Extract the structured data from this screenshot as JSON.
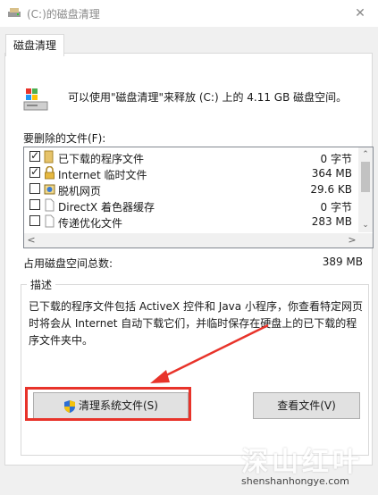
{
  "window": {
    "title": "(C:)的磁盘清理",
    "close_glyph": "✕"
  },
  "tab": {
    "label": "磁盘清理"
  },
  "header": {
    "info": "可以使用\"磁盘清理\"来释放 (C:) 上的 4.11 GB 磁盘空间。"
  },
  "files_label": "要删除的文件(F):",
  "files": [
    {
      "name": "已下载的程序文件",
      "size": "0 字节",
      "checked": true,
      "icon": "folder-icon"
    },
    {
      "name": "Internet 临时文件",
      "size": "364 MB",
      "checked": true,
      "icon": "lock-icon"
    },
    {
      "name": "脱机网页",
      "size": "29.6 KB",
      "checked": false,
      "icon": "offline-page-icon"
    },
    {
      "name": "DirectX 着色器缓存",
      "size": "0 字节",
      "checked": false,
      "icon": "file-icon"
    },
    {
      "name": "传递优化文件",
      "size": "283 MB",
      "checked": false,
      "icon": "file-icon"
    }
  ],
  "scroll": {
    "up": "⌃",
    "down": "⌄",
    "left": "<",
    "right": ">"
  },
  "total": {
    "label": "占用磁盘空间总数:",
    "value": "389 MB"
  },
  "description": {
    "title": "描述",
    "text": "已下载的程序文件包括 ActiveX 控件和 Java 小程序，你查看特定网页时将会从 Internet 自动下载它们，并临时保存在硬盘上的已下载的程序文件夹中。"
  },
  "buttons": {
    "clean_system": "清理系统文件(S)",
    "view_files": "查看文件(V)"
  },
  "watermark": {
    "text": "深山红叶",
    "url": "shenshanhongye.com"
  },
  "colors": {
    "highlight": "#e8332a",
    "window_bg": "#f0f0f0"
  }
}
